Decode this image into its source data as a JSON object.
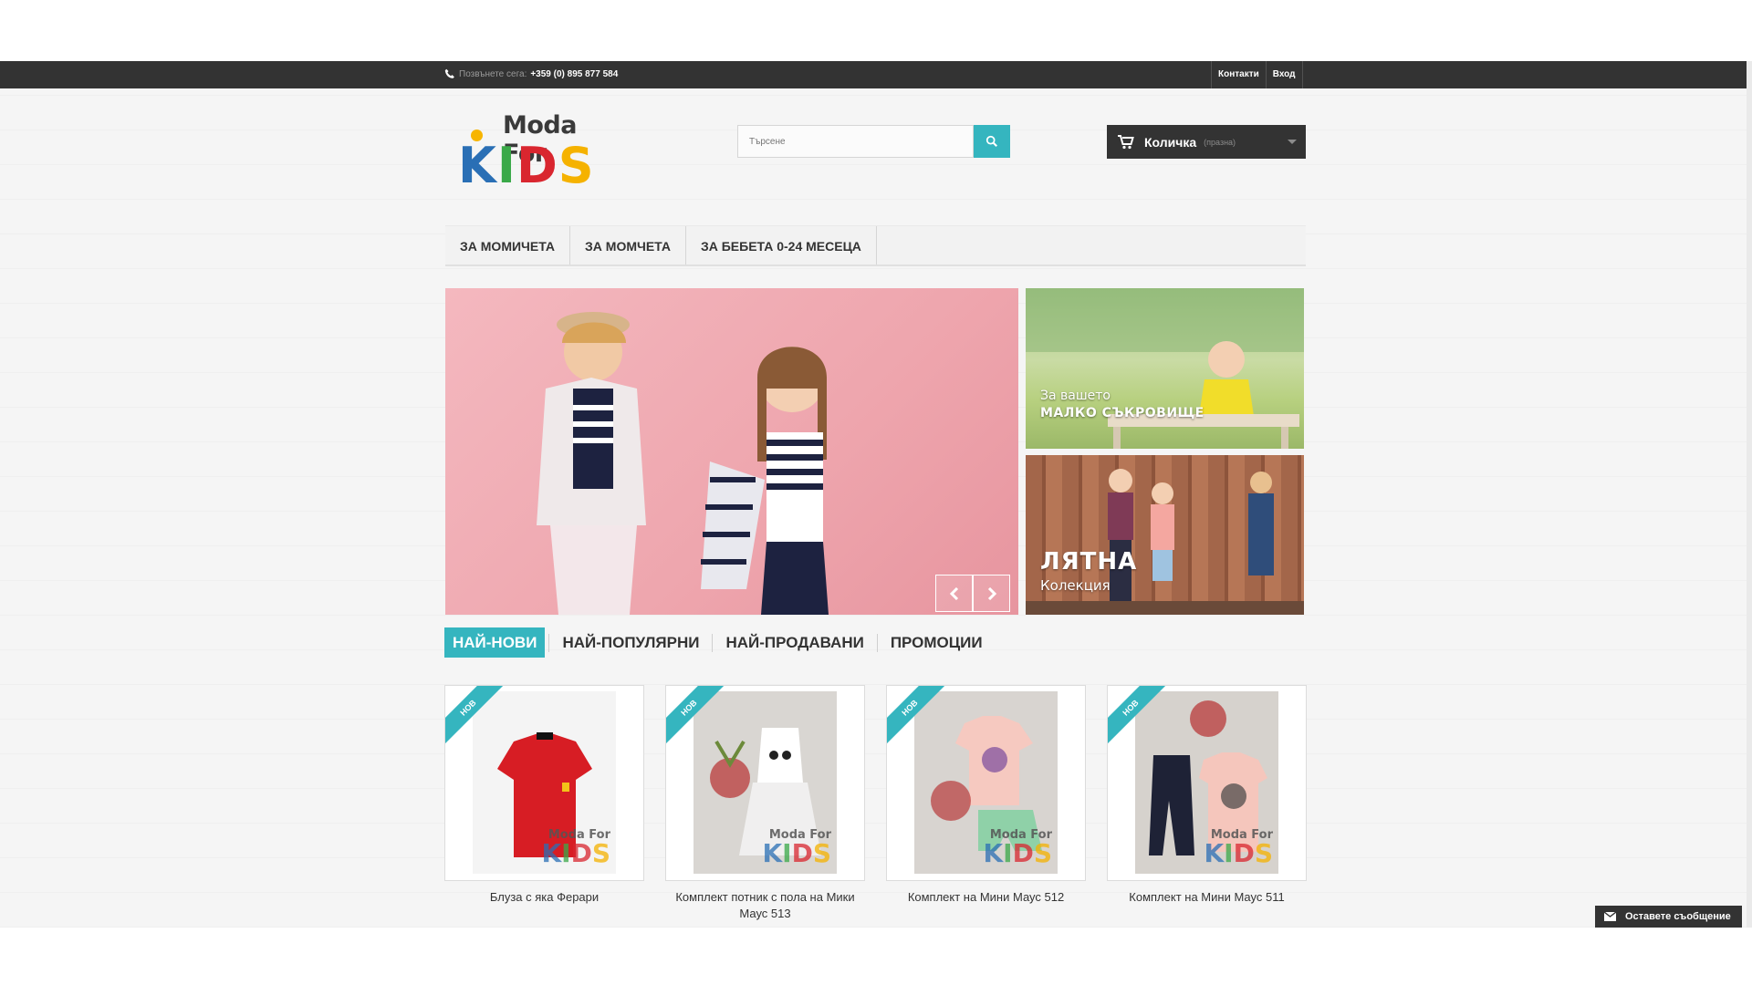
{
  "topbar": {
    "call_label": "Позвънете сега:",
    "phone": "+359 (0) 895 877 584",
    "links": [
      "Контакти",
      "Вход"
    ]
  },
  "logo": {
    "line1": "Moda For",
    "line2": [
      "K",
      "I",
      "D",
      "S"
    ]
  },
  "search": {
    "placeholder": "Търсене"
  },
  "cart": {
    "label": "Количка",
    "status": "(празна)"
  },
  "menu": [
    "ЗА МОМИЧЕТА",
    "ЗА МОМЧЕТА",
    "ЗА БЕБЕТА 0-24 МЕСЕЦА"
  ],
  "banners": [
    {
      "line1": "За вашето",
      "line2": "МАЛКО СЪКРОВИЩЕ"
    },
    {
      "line1": "ЛЯТНА",
      "line2": "Колекция"
    }
  ],
  "tabs": [
    "НАЙ-НОВИ",
    "НАЙ-ПОПУЛЯРНИ",
    "НАЙ-ПРОДАВАНИ",
    "ПРОМОЦИИ"
  ],
  "product_badge": "НОВ",
  "products": [
    {
      "name": "Блуза с яка Ферари"
    },
    {
      "name": "Комплект потник с пола на Мики Маус 513"
    },
    {
      "name": "Комплект на Мини Маус 512"
    },
    {
      "name": "Комплект на Мини Маус 511"
    }
  ],
  "message_button": "Оставете съобщение",
  "colors": {
    "accent": "#35b5bf",
    "dark": "#333333"
  }
}
